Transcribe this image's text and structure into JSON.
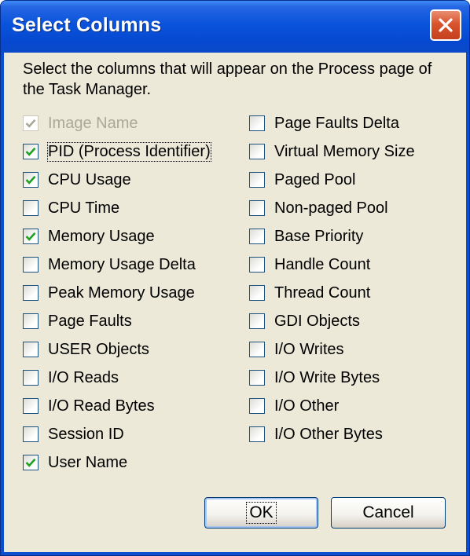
{
  "window": {
    "title": "Select Columns"
  },
  "description": "Select the columns that will appear on the Process page of the Task Manager.",
  "columns_left": [
    {
      "label": "Image Name",
      "checked": true,
      "disabled": true
    },
    {
      "label": "PID (Process Identifier)",
      "checked": true,
      "focused": true
    },
    {
      "label": "CPU Usage",
      "checked": true
    },
    {
      "label": "CPU Time",
      "checked": false
    },
    {
      "label": "Memory Usage",
      "checked": true
    },
    {
      "label": "Memory Usage Delta",
      "checked": false
    },
    {
      "label": "Peak Memory Usage",
      "checked": false
    },
    {
      "label": "Page Faults",
      "checked": false
    },
    {
      "label": "USER Objects",
      "checked": false
    },
    {
      "label": "I/O Reads",
      "checked": false
    },
    {
      "label": "I/O Read Bytes",
      "checked": false
    },
    {
      "label": "Session ID",
      "checked": false
    },
    {
      "label": "User Name",
      "checked": true
    }
  ],
  "columns_right": [
    {
      "label": "Page Faults Delta",
      "checked": false
    },
    {
      "label": "Virtual Memory Size",
      "checked": false
    },
    {
      "label": "Paged Pool",
      "checked": false
    },
    {
      "label": "Non-paged Pool",
      "checked": false
    },
    {
      "label": "Base Priority",
      "checked": false
    },
    {
      "label": "Handle Count",
      "checked": false
    },
    {
      "label": "Thread Count",
      "checked": false
    },
    {
      "label": "GDI Objects",
      "checked": false
    },
    {
      "label": "I/O Writes",
      "checked": false
    },
    {
      "label": "I/O Write Bytes",
      "checked": false
    },
    {
      "label": "I/O Other",
      "checked": false
    },
    {
      "label": "I/O Other Bytes",
      "checked": false
    }
  ],
  "buttons": {
    "ok": "OK",
    "cancel": "Cancel"
  },
  "icons": {
    "close": "close-icon",
    "check": "checkmark-icon"
  },
  "colors": {
    "titlebar": "#0a53db",
    "dialog_background": "#ece9d8",
    "checkmark": "#21a121",
    "close_button": "#d9542e"
  }
}
